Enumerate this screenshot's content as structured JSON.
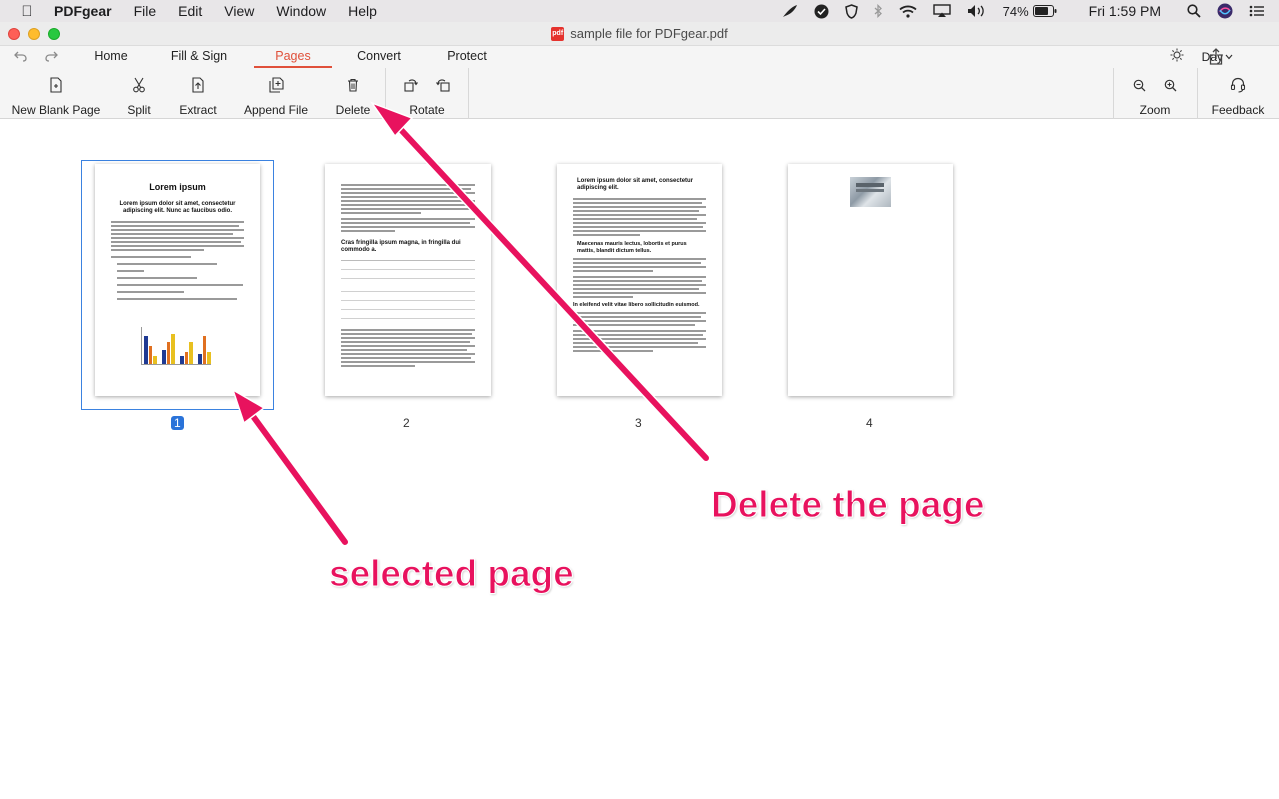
{
  "menubar": {
    "app_name": "PDFgear",
    "items": [
      "File",
      "Edit",
      "View",
      "Window",
      "Help"
    ],
    "battery": "74%",
    "clock": "Fri 1:59 PM"
  },
  "window": {
    "title": "sample file for PDFgear.pdf"
  },
  "tabs": [
    {
      "label": "Home"
    },
    {
      "label": "Fill & Sign"
    },
    {
      "label": "Pages",
      "active": true
    },
    {
      "label": "Convert"
    },
    {
      "label": "Protect"
    }
  ],
  "theme": {
    "label": "Day"
  },
  "toolbar": {
    "new_blank_page": "New Blank Page",
    "split": "Split",
    "extract": "Extract",
    "append_file": "Append File",
    "delete": "Delete",
    "rotate": "Rotate",
    "zoom": "Zoom",
    "feedback": "Feedback"
  },
  "pages": [
    {
      "number": "1",
      "selected": true,
      "heading": "Lorem ipsum",
      "subheading": "Lorem ipsum dolor sit amet, consectetur adipiscing elit. Nunc ac faucibus odio."
    },
    {
      "number": "2",
      "heading": "Cras fringilla ipsum magna, in fringilla dui commodo a."
    },
    {
      "number": "3",
      "heading": "Lorem ipsum dolor sit amet, consectetur adipiscing elit.",
      "subheading": "Maecenas mauris lectus, lobortis et purus mattis, blandit dictum tellus.",
      "subheading2": "In eleifend velit vitae libero sollicitudin euismod."
    },
    {
      "number": "4"
    }
  ],
  "annotations": {
    "delete_note": "Delete the page",
    "selected_note": "selected page"
  },
  "colors": {
    "accent_tab": "#e0503a",
    "selection": "#2a73d9",
    "annotation": "#e8125e"
  }
}
